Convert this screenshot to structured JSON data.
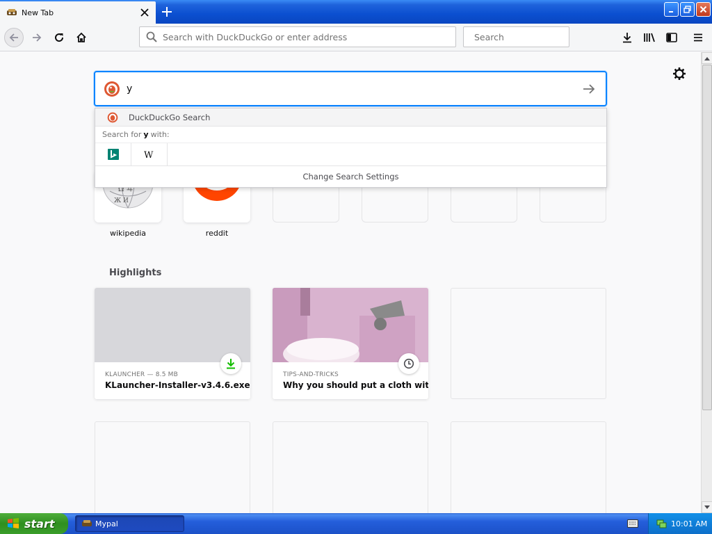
{
  "tab": {
    "title": "New Tab"
  },
  "toolbar": {
    "url_placeholder": "Search with DuckDuckGo or enter address",
    "search_placeholder": "Search"
  },
  "search": {
    "query": "y",
    "suggestion": "DuckDuckGo Search",
    "hint_prefix": "Search for",
    "hint_term": "y",
    "hint_suffix": "with:",
    "engines": [
      "bing-icon",
      "wikipedia-icon"
    ],
    "settings_label": "Change Search Settings"
  },
  "topsites": [
    {
      "label": "wikipedia"
    },
    {
      "label": "reddit"
    }
  ],
  "highlights": {
    "title": "Highlights",
    "cards": [
      {
        "meta": "KLAUNCHER — 8.5 MB",
        "title": "KLauncher-Installer-v3.4.6.exe",
        "badge": "download-icon"
      },
      {
        "meta": "TIPS-AND-TRICKS",
        "title": "Why you should put a cloth with ...",
        "badge": "clock-icon"
      }
    ]
  },
  "taskbar": {
    "start_label": "start",
    "task_label": "Mypal",
    "clock": "10:01 AM"
  },
  "colors": {
    "accent": "#0a84ff",
    "taskbar": "#245edb",
    "download_green": "#12bc00"
  }
}
